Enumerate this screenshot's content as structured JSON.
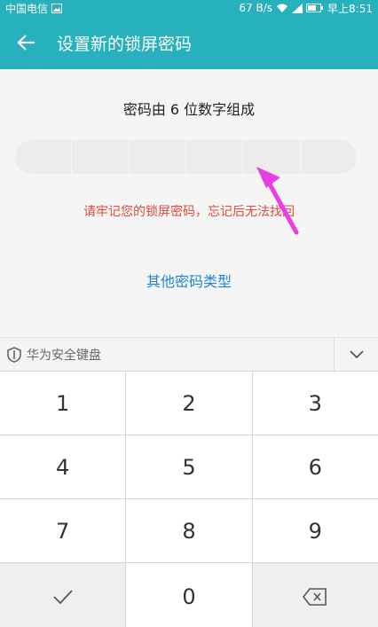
{
  "status_bar": {
    "carrier": "中国电信",
    "speed": "67 B/s",
    "time": "早上8:51"
  },
  "app_bar": {
    "title": "设置新的锁屏密码"
  },
  "content": {
    "prompt": "密码由 6 位数字组成",
    "pin_slots": 6,
    "warning": "请牢记您的锁屏密码，忘记后无法找回",
    "other_type": "其他密码类型"
  },
  "keyboard": {
    "brand": "华为安全键盘",
    "keys": [
      "1",
      "2",
      "3",
      "4",
      "5",
      "6",
      "7",
      "8",
      "9",
      "0"
    ]
  },
  "colors": {
    "accent": "#26b1bd",
    "warning": "#e04b3a",
    "link": "#1f84d6",
    "annotation": "#e93ee2"
  }
}
